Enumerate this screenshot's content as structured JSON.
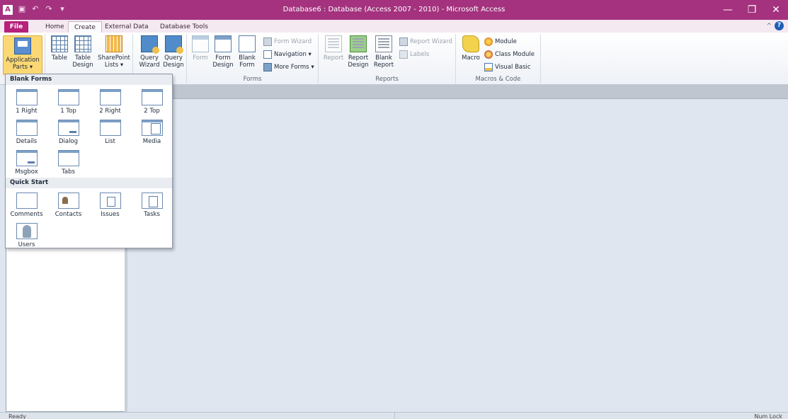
{
  "titlebar": {
    "app_icon": "A",
    "title": "Database6 : Database (Access 2007 - 2010)  -  Microsoft Access",
    "qat_icons": [
      "save-icon",
      "undo-icon",
      "redo-icon",
      "customize-icon"
    ],
    "controls": {
      "minimize": "—",
      "restore": "❐",
      "close": "✕"
    }
  },
  "tabs": {
    "file": "File",
    "home": "Home",
    "create": "Create",
    "external_data": "External Data",
    "database_tools": "Database Tools"
  },
  "help": {
    "collapse": "^",
    "help": "?"
  },
  "ribbon": {
    "templates": {
      "application_parts": "Application\nParts ▾"
    },
    "tables": {
      "table": "Table",
      "table_design": "Table\nDesign",
      "sharepoint_lists": "SharePoint\nLists ▾"
    },
    "queries": {
      "query_wizard": "Query\nWizard",
      "query_design": "Query\nDesign"
    },
    "forms": {
      "label": "Forms",
      "form": "Form",
      "form_design": "Form\nDesign",
      "blank_form": "Blank\nForm",
      "form_wizard": "Form Wizard",
      "navigation": "Navigation ▾",
      "more_forms": "More Forms ▾"
    },
    "reports": {
      "label": "Reports",
      "report": "Report",
      "report_design": "Report\nDesign",
      "blank_report": "Blank\nReport",
      "report_wizard": "Report Wizard",
      "labels": "Labels"
    },
    "macros": {
      "label": "Macros & Code",
      "macro": "Macro",
      "module": "Module",
      "class_module": "Class Module",
      "visual_basic": "Visual Basic"
    }
  },
  "dropdown": {
    "blank_forms_header": "Blank Forms",
    "blank_forms": [
      "1 Right",
      "1 Top",
      "2 Right",
      "2 Top",
      "Details",
      "Dialog",
      "List",
      "Media",
      "Msgbox",
      "Tabs"
    ],
    "quick_start_header": "Quick Start",
    "quick_start": [
      "Comments",
      "Contacts",
      "Issues",
      "Tasks",
      "Users"
    ]
  },
  "statusbar": {
    "left": "Ready",
    "right": "Num Lock"
  }
}
